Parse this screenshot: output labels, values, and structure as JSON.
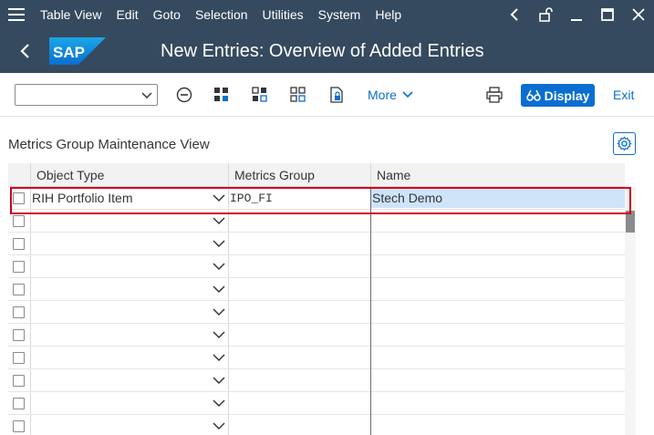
{
  "menubar": {
    "items": [
      {
        "label": "Table View"
      },
      {
        "label": "Edit"
      },
      {
        "label": "Goto"
      },
      {
        "label": "Selection"
      },
      {
        "label": "Utilities"
      },
      {
        "label": "System"
      },
      {
        "label": "Help"
      }
    ]
  },
  "titlebar": {
    "logo": "SAP",
    "title": "New Entries: Overview of Added Entries"
  },
  "toolbar": {
    "command_value": "",
    "more_label": "More",
    "display_label": "Display",
    "exit_label": "Exit",
    "icons": [
      "minus-circle-icon",
      "select-all-icon",
      "select-block-icon",
      "deselect-all-icon",
      "lock-doc-icon",
      "print-icon"
    ]
  },
  "section": {
    "title": "Metrics Group Maintenance View"
  },
  "table": {
    "columns": [
      "Object Type",
      "Metrics Group",
      "Name"
    ],
    "rows": [
      {
        "object_type": "RIH Portfolio Item",
        "metrics_group": "IPO_FI",
        "name": "Stech Demo"
      },
      {
        "object_type": "",
        "metrics_group": "",
        "name": ""
      },
      {
        "object_type": "",
        "metrics_group": "",
        "name": ""
      },
      {
        "object_type": "",
        "metrics_group": "",
        "name": ""
      },
      {
        "object_type": "",
        "metrics_group": "",
        "name": ""
      },
      {
        "object_type": "",
        "metrics_group": "",
        "name": ""
      },
      {
        "object_type": "",
        "metrics_group": "",
        "name": ""
      },
      {
        "object_type": "",
        "metrics_group": "",
        "name": ""
      },
      {
        "object_type": "",
        "metrics_group": "",
        "name": ""
      },
      {
        "object_type": "",
        "metrics_group": "",
        "name": ""
      },
      {
        "object_type": "",
        "metrics_group": "",
        "name": ""
      }
    ]
  },
  "colors": {
    "shell": "#354a5f",
    "accent": "#0a6ed1",
    "highlight_border": "#d0021b",
    "active_cell": "#cde4f9"
  }
}
